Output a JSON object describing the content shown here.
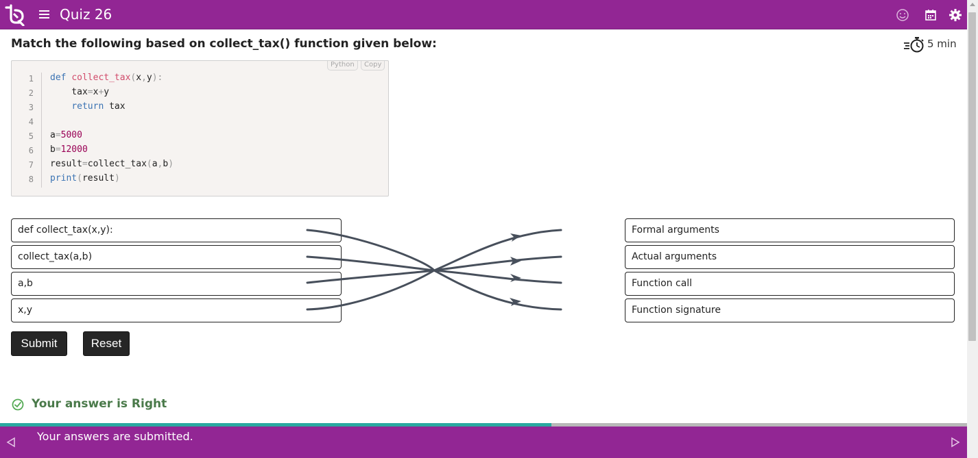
{
  "header": {
    "title": "Quiz 26",
    "icons": [
      "app-logo",
      "hamburger-menu-icon",
      "smiley-icon",
      "calendar-icon",
      "settings-gear-icon"
    ],
    "brand_color": "#922694"
  },
  "question": {
    "text": "Match the following based on collect_tax() function given below:",
    "timer": "5 min"
  },
  "code": {
    "language": "Python",
    "copy_label": "Copy",
    "line_numbers": [
      "1",
      "2",
      "3",
      "4",
      "5",
      "6",
      "7",
      "8"
    ]
  },
  "matching": {
    "left": [
      "def collect_tax(x,y):",
      "collect_tax(a,b)",
      "a,b",
      "x,y"
    ],
    "right": [
      "Formal arguments",
      "Actual arguments",
      "Function call",
      "Function signature"
    ],
    "connection_color": "#474f5b"
  },
  "buttons": {
    "submit": "Submit",
    "reset": "Reset"
  },
  "result": {
    "text": "Your answer is Right",
    "color": "#4a7a4a"
  },
  "progress": {
    "fraction": 0.57
  },
  "footer": {
    "message": "Your answers are submitted."
  }
}
